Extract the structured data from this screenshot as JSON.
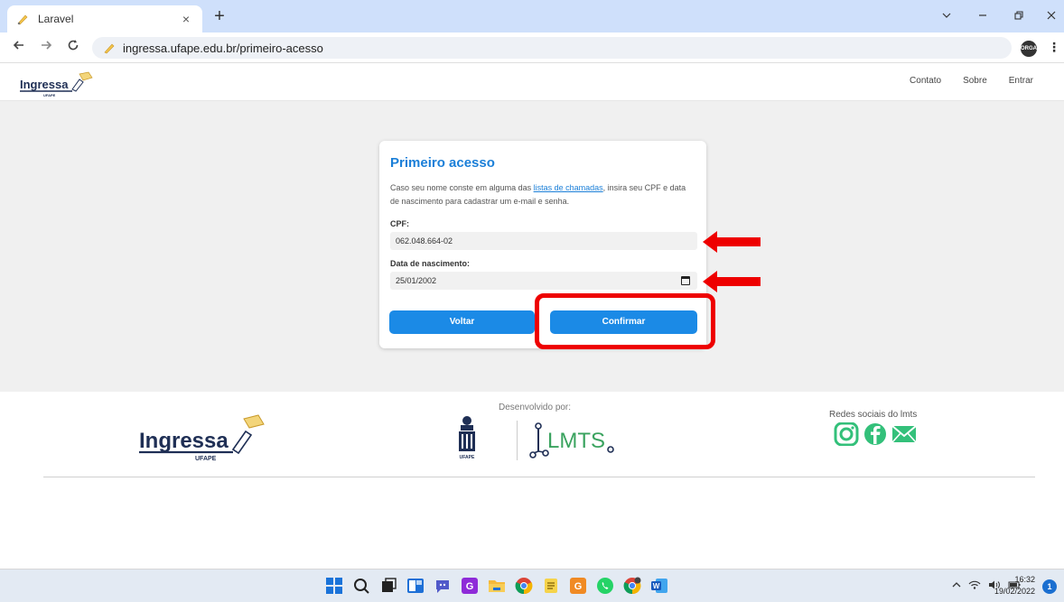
{
  "browser": {
    "tab_title": "Laravel",
    "tab_close": "×",
    "new_tab": "+",
    "url": "ingressa.ufape.edu.br/primeiro-acesso",
    "profile_label": "ORGA"
  },
  "header": {
    "logo_text": "Ingressa",
    "logo_sub": "UFAPE",
    "nav": [
      "Contato",
      "Sobre",
      "Entrar"
    ]
  },
  "card": {
    "title": "Primeiro acesso",
    "desc_pre": "Caso seu nome conste em alguma das ",
    "desc_link": "listas de chamadas",
    "desc_post": ", insira seu CPF e data de nascimento para cadastrar um e-mail e senha.",
    "cpf_label": "CPF:",
    "cpf_value": "062.048.664-02",
    "birth_label": "Data de nascimento:",
    "birth_value": "25/01/2002",
    "back_label": "Voltar",
    "confirm_label": "Confirmar"
  },
  "footer": {
    "developed_by": "Desenvolvido por:",
    "logo_text": "Ingressa",
    "logo_sub": "UFAPE",
    "ufape_label": "UFAPE",
    "lmts_text": "LMTS",
    "social_label": "Redes sociais do lmts",
    "social": [
      "instagram-icon",
      "facebook-icon",
      "email-icon"
    ]
  },
  "taskbar": {
    "time": "16:32",
    "date": "19/02/2022",
    "notifications": "1"
  },
  "colors": {
    "accent": "#1b8ae6",
    "title": "#1b7fd8",
    "annotation": "#ee0000",
    "lmts_green": "#3aa35f"
  }
}
